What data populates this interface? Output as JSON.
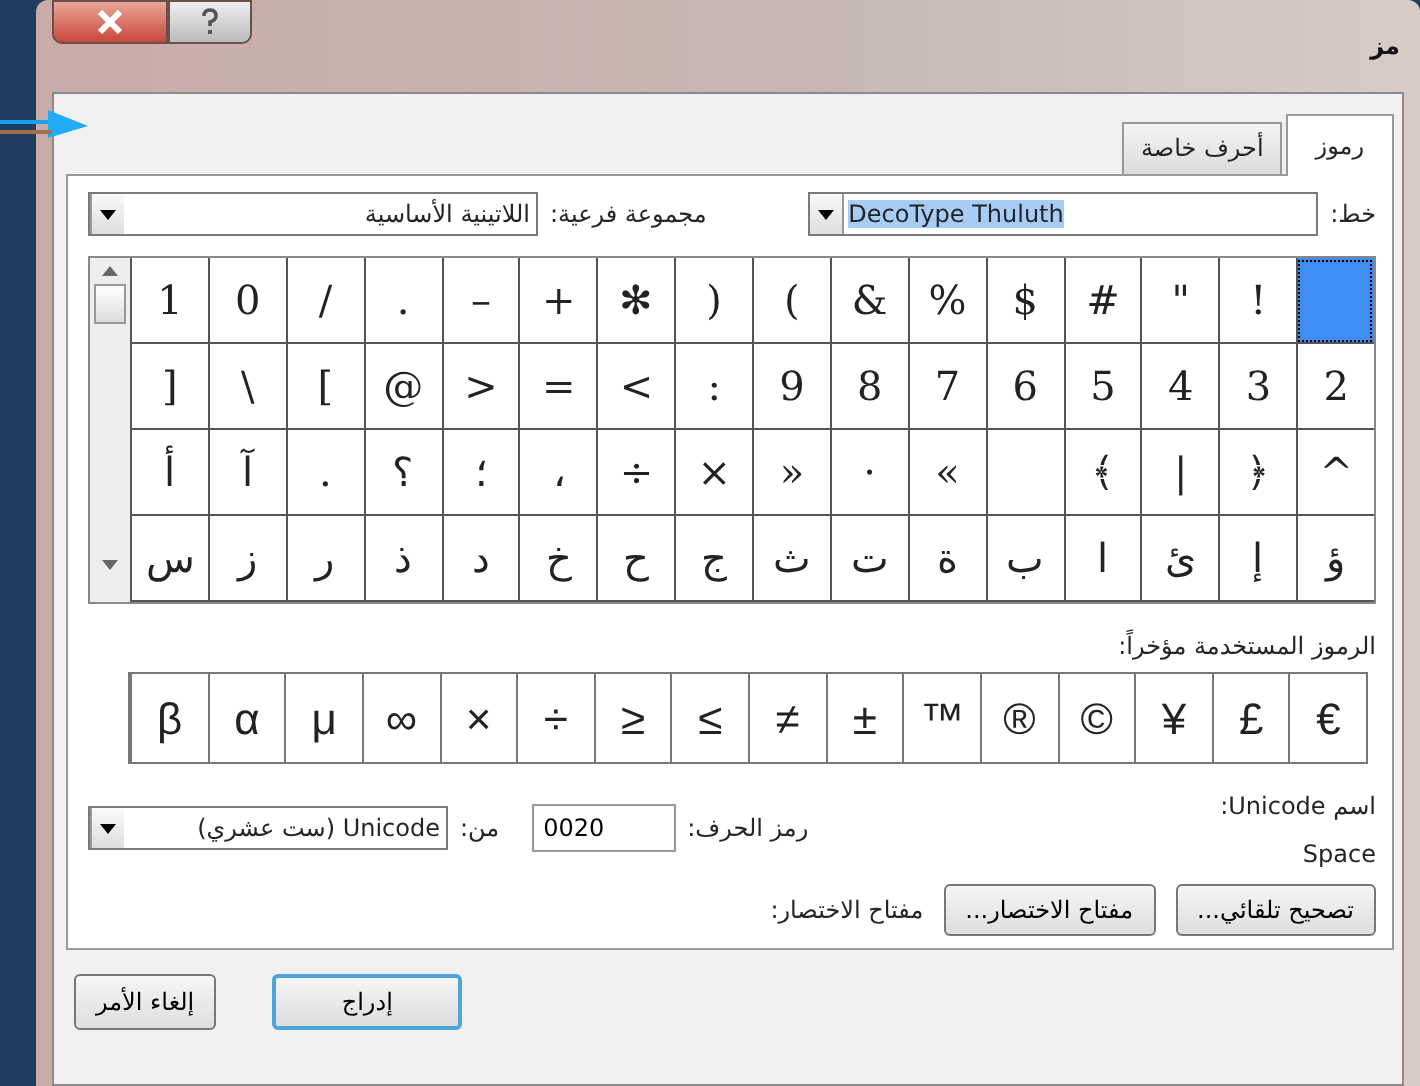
{
  "window": {
    "title": "مز"
  },
  "tabs": [
    {
      "label": "رموز",
      "selected": true
    },
    {
      "label": "أحرف خاصة",
      "selected": false
    }
  ],
  "font": {
    "label": "خط:",
    "value": "DecoType Thuluth"
  },
  "subset": {
    "label": "مجموعة فرعية:",
    "value": "اللاتينية الأساسية"
  },
  "symbols": [
    [
      {
        "selected": true
      },
      {
        "char": "!",
        "selected": false
      },
      {
        "char": "\"",
        "selected": false
      },
      {
        "char": "#",
        "selected": false
      },
      {
        "char": "$",
        "selected": false
      },
      {
        "char": "%",
        "selected": false
      },
      {
        "char": "&",
        "selected": false
      },
      {
        "char": ")",
        "selected": false
      },
      {
        "char": "(",
        "selected": false
      },
      {
        "char": "✻",
        "selected": false
      },
      {
        "char": "+",
        "selected": false
      },
      {
        "char": "–",
        "selected": false
      },
      {
        "char": ".",
        "selected": false
      },
      {
        "char": "/",
        "selected": false
      },
      {
        "char": "0",
        "selected": false
      },
      {
        "char": "1",
        "selected": false
      }
    ],
    [
      {
        "char": "2",
        "selected": false
      },
      {
        "char": "3",
        "selected": false
      },
      {
        "char": "4",
        "selected": false
      },
      {
        "char": "5",
        "selected": false
      },
      {
        "char": "6",
        "selected": false
      },
      {
        "char": "7",
        "selected": false
      },
      {
        "char": "8",
        "selected": false
      },
      {
        "char": "9",
        "selected": false
      },
      {
        "char": ":",
        "selected": false
      },
      {
        "char": ">",
        "selected": false
      },
      {
        "char": "=",
        "selected": false
      },
      {
        "char": "<",
        "selected": false
      },
      {
        "char": "@",
        "selected": false
      },
      {
        "char": "]",
        "selected": false
      },
      {
        "char": "\\",
        "selected": false
      },
      {
        "char": "[",
        "selected": false
      }
    ],
    [
      {
        "char": "^",
        "selected": false
      },
      {
        "char": "﴿",
        "selected": false
      },
      {
        "char": "|",
        "selected": false
      },
      {
        "char": "﴾",
        "selected": false
      },
      {
        "selected": false
      },
      {
        "char": "»",
        "selected": false
      },
      {
        "char": "·",
        "selected": false
      },
      {
        "char": "«",
        "selected": false
      },
      {
        "char": "×",
        "selected": false
      },
      {
        "char": "÷",
        "selected": false
      },
      {
        "char": "،",
        "selected": false
      },
      {
        "char": "؛",
        "selected": false
      },
      {
        "char": "؟",
        "selected": false
      },
      {
        "char": ".",
        "selected": false
      },
      {
        "char": "آ",
        "selected": false
      },
      {
        "char": "أ",
        "selected": false
      }
    ],
    [
      {
        "char": "ؤ",
        "selected": false
      },
      {
        "char": "إ",
        "selected": false
      },
      {
        "char": "ئ",
        "selected": false
      },
      {
        "char": "ا",
        "selected": false
      },
      {
        "char": "ب",
        "selected": false
      },
      {
        "char": "ة",
        "selected": false
      },
      {
        "char": "ت",
        "selected": false
      },
      {
        "char": "ث",
        "selected": false
      },
      {
        "char": "ج",
        "selected": false
      },
      {
        "char": "ح",
        "selected": false
      },
      {
        "char": "خ",
        "selected": false
      },
      {
        "char": "د",
        "selected": false
      },
      {
        "char": "ذ",
        "selected": false
      },
      {
        "char": "ر",
        "selected": false
      },
      {
        "char": "ز",
        "selected": false
      },
      {
        "char": "س",
        "selected": false
      }
    ]
  ],
  "recent": {
    "label": "الرموز المستخدمة مؤخراً:",
    "symbols": [
      "€",
      "£",
      "¥",
      "©",
      "®",
      "™",
      "±",
      "≠",
      "≥",
      "≤",
      "÷",
      "×",
      "∞",
      "μ",
      "α",
      "β"
    ]
  },
  "unicode_name": {
    "label": "اسم Unicode:",
    "value": "Space"
  },
  "char_code": {
    "label": "رمز الحرف:",
    "value": "0020"
  },
  "from": {
    "label": "من:",
    "value": "Unicode (ست عشري)"
  },
  "buttons": [
    {
      "label": "تصحيح تلقائي..."
    },
    {
      "label": "مفتاح الاختصار..."
    }
  ],
  "shortcut": {
    "label": "مفتاح الاختصار:"
  },
  "footer": [
    {
      "label": "إدراج",
      "default": true
    },
    {
      "label": "إلغاء الأمر",
      "default": false
    }
  ]
}
